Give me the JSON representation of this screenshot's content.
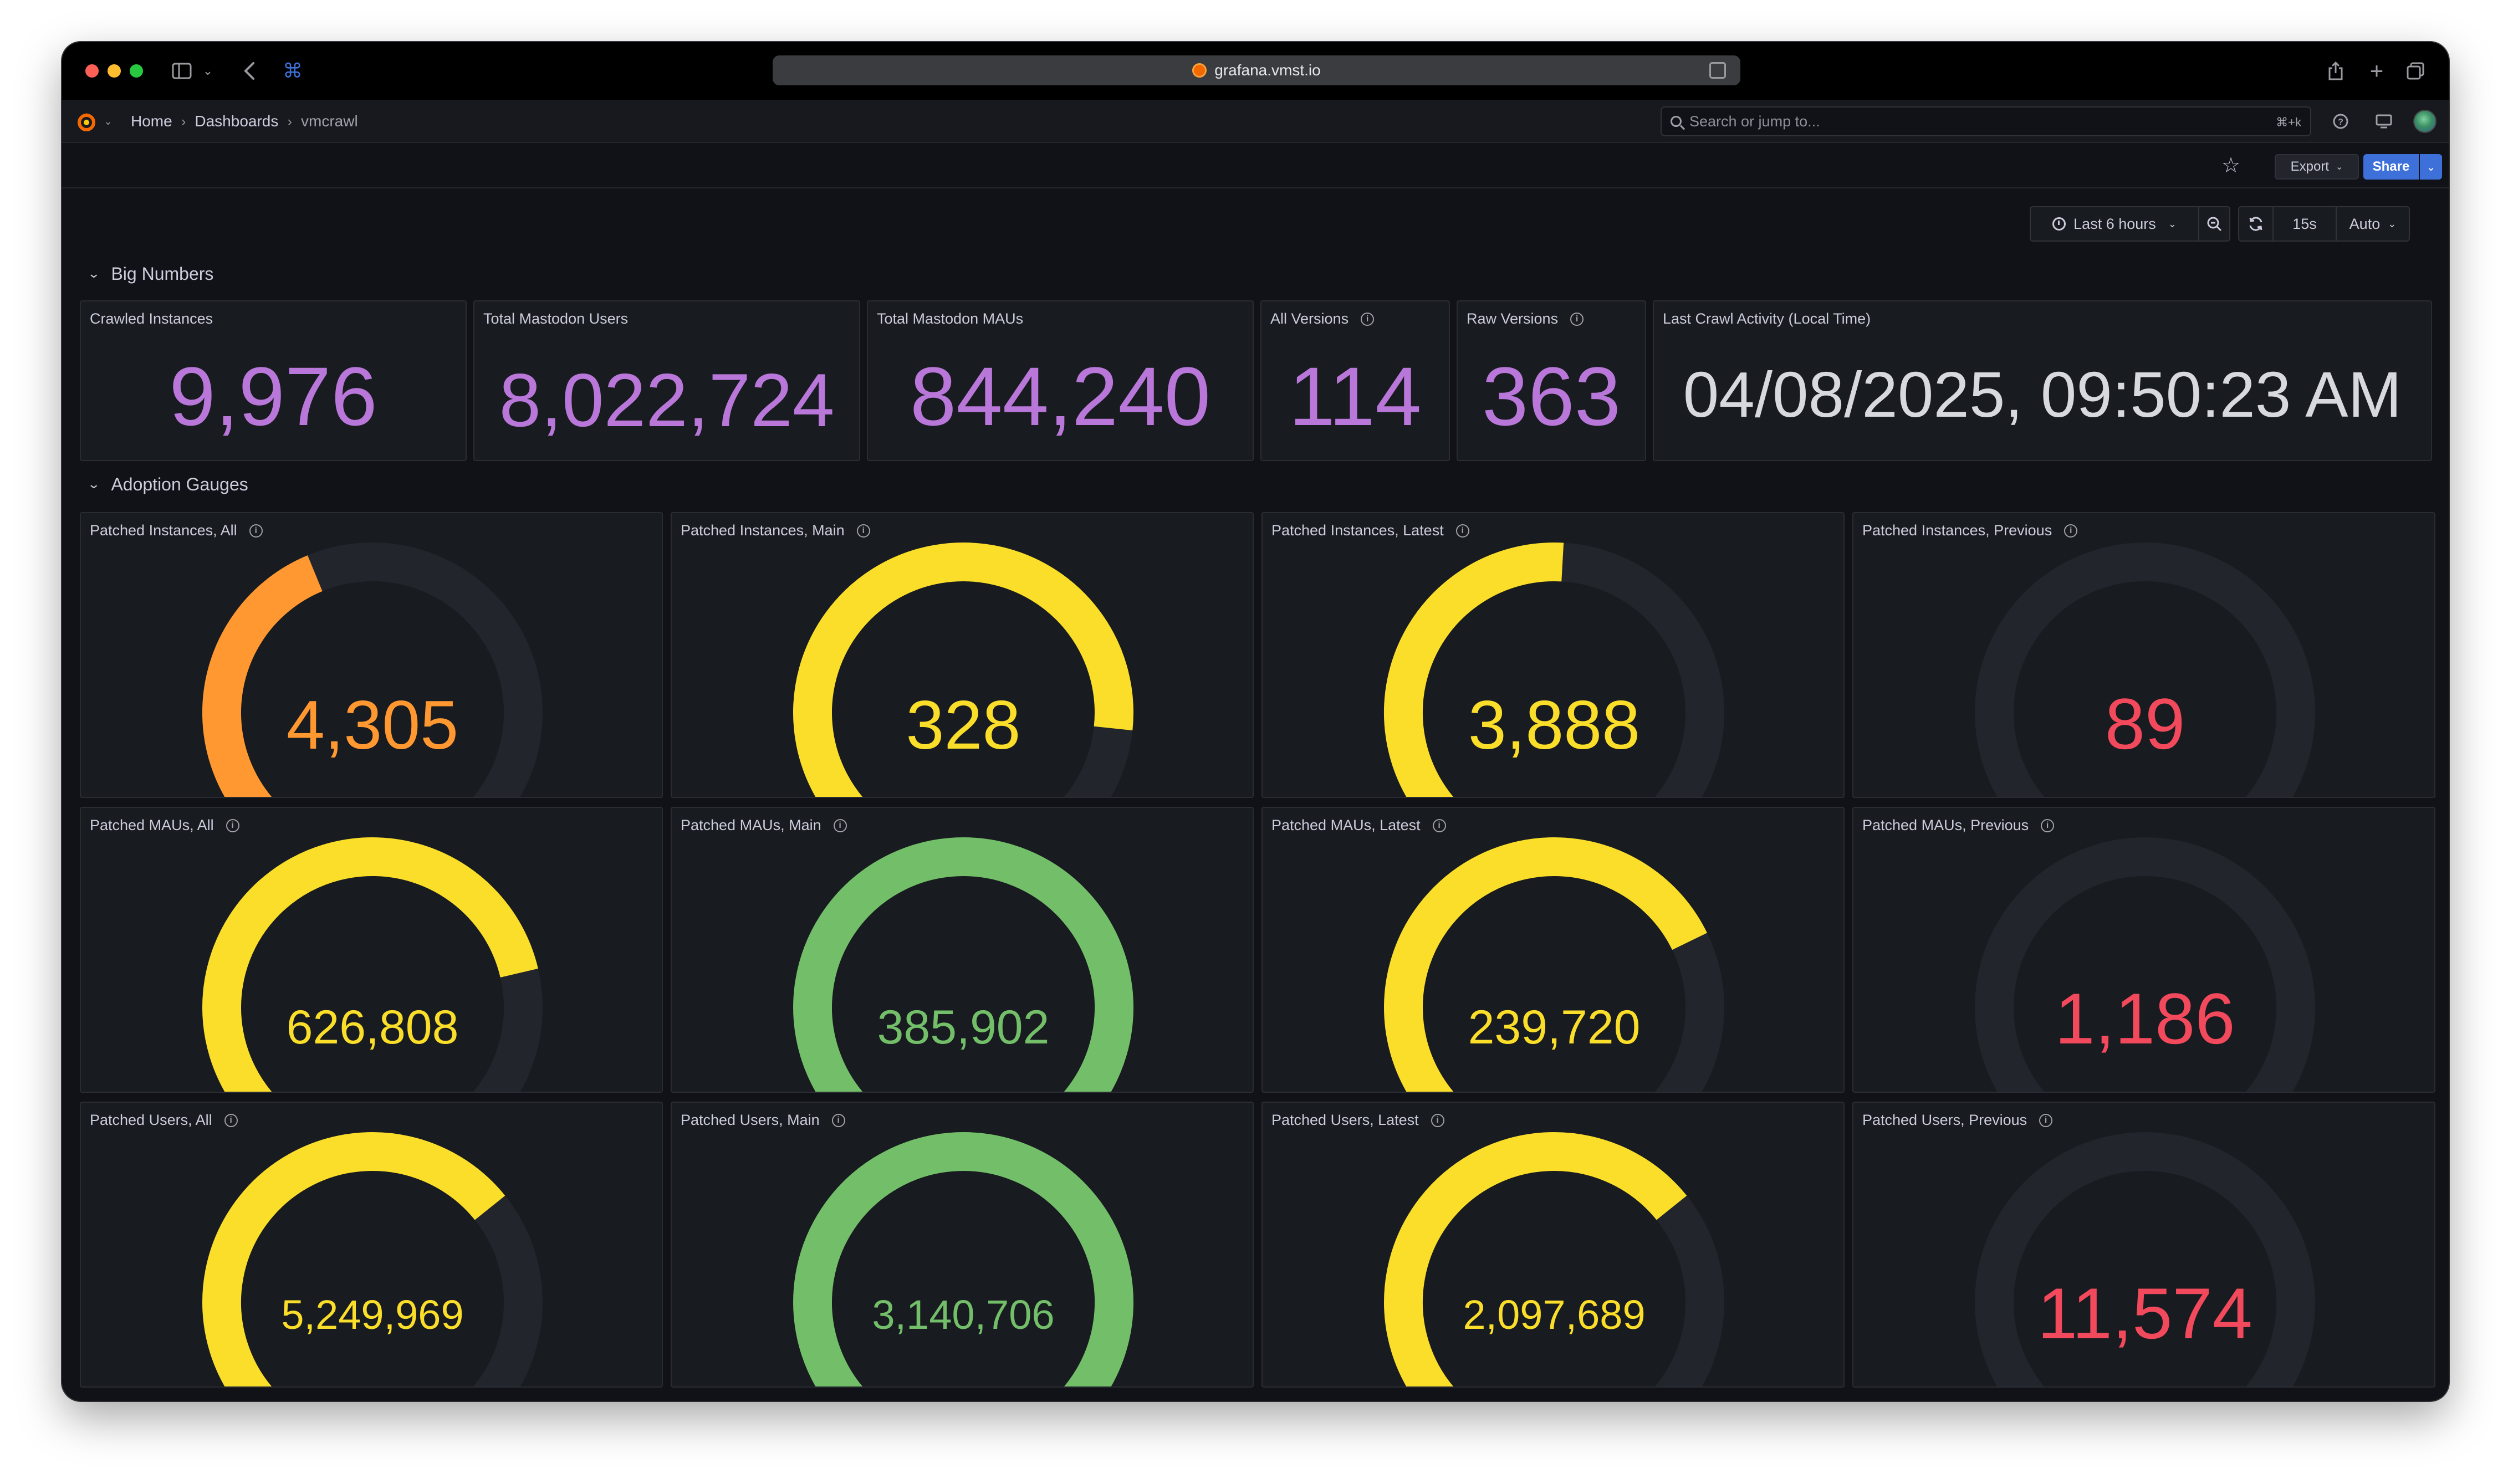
{
  "browser": {
    "url": "grafana.vmst.io"
  },
  "topnav": {
    "breadcrumb": [
      "Home",
      "Dashboards",
      "vmcrawl"
    ],
    "search_placeholder": "Search or jump to...",
    "search_shortcut": "⌘+k"
  },
  "toolbar": {
    "export_label": "Export",
    "share_label": "Share"
  },
  "time_controls": {
    "range": "Last 6 hours",
    "refresh_interval": "15s",
    "auto_label": "Auto"
  },
  "rows": {
    "big_numbers": "Big Numbers",
    "adoption_gauges": "Adoption Gauges"
  },
  "stats": [
    {
      "title": "Crawled Instances",
      "value": "9,976",
      "info": false
    },
    {
      "title": "Total Mastodon Users",
      "value": "8,022,724",
      "info": false
    },
    {
      "title": "Total Mastodon MAUs",
      "value": "844,240",
      "info": false
    },
    {
      "title": "All Versions",
      "value": "114",
      "info": true
    },
    {
      "title": "Raw Versions",
      "value": "363",
      "info": true
    },
    {
      "title": "Last Crawl Activity (Local Time)",
      "value": "04/08/2025, 09:50:23 AM",
      "info": false
    }
  ],
  "gauges": [
    {
      "title": "Patched Instances, All",
      "value": "4,305",
      "fraction": 0.43,
      "color": "#ff9830"
    },
    {
      "title": "Patched Instances, Main",
      "value": "328",
      "fraction": 0.8,
      "color": "#fade2a"
    },
    {
      "title": "Patched Instances, Latest",
      "value": "3,888",
      "fraction": 0.51,
      "color": "#fade2a"
    },
    {
      "title": "Patched Instances, Previous",
      "value": "89",
      "fraction": 0.04,
      "color": "#f2495c"
    },
    {
      "title": "Patched MAUs, All",
      "value": "626,808",
      "fraction": 0.74,
      "color": "#fade2a"
    },
    {
      "title": "Patched MAUs, Main",
      "value": "385,902",
      "fraction": 0.97,
      "color": "#73bf69"
    },
    {
      "title": "Patched MAUs, Latest",
      "value": "239,720",
      "fraction": 0.7,
      "color": "#fade2a"
    },
    {
      "title": "Patched MAUs, Previous",
      "value": "1,186",
      "fraction": 0.02,
      "color": "#f2495c"
    },
    {
      "title": "Patched Users, All",
      "value": "5,249,969",
      "fraction": 0.66,
      "color": "#fade2a"
    },
    {
      "title": "Patched Users, Main",
      "value": "3,140,706",
      "fraction": 0.97,
      "color": "#73bf69"
    },
    {
      "title": "Patched Users, Latest",
      "value": "2,097,689",
      "fraction": 0.66,
      "color": "#fade2a"
    },
    {
      "title": "Patched Users, Previous",
      "value": "11,574",
      "fraction": 0.02,
      "color": "#f2495c"
    }
  ]
}
